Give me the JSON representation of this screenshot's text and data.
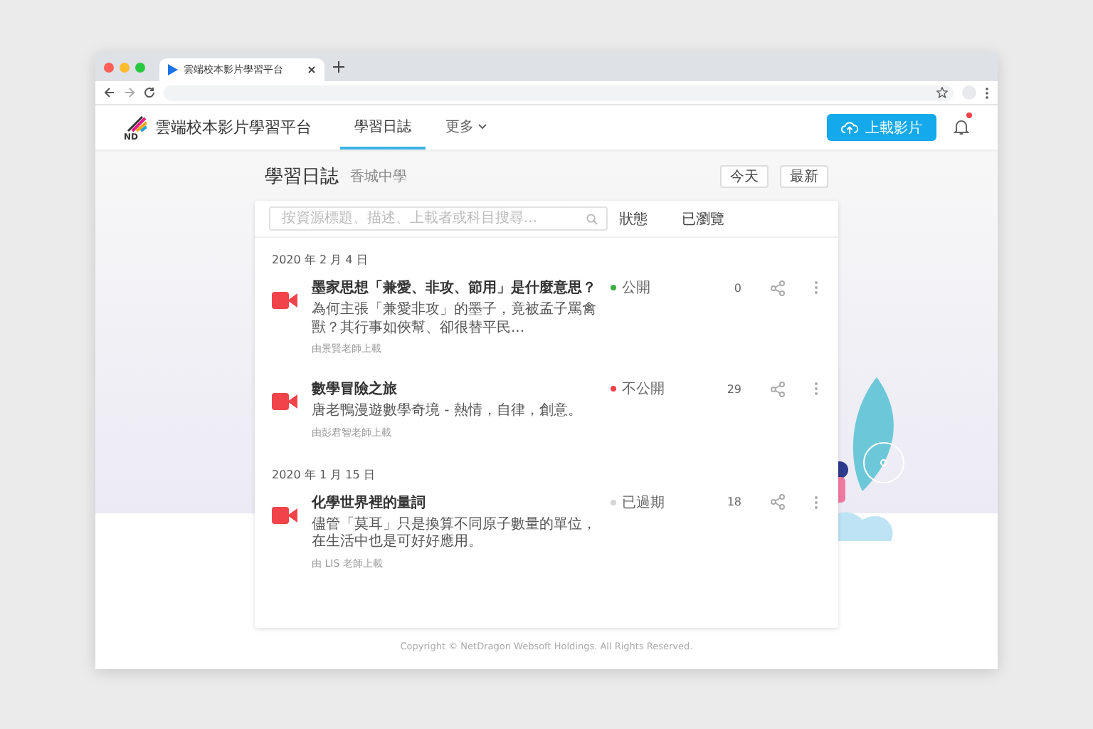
{
  "browser": {
    "tab_title": "雲端校本影片學習平台"
  },
  "header": {
    "logo_text": "ND",
    "brand": "雲端校本影片學習平台",
    "nav": [
      {
        "label": "學習日誌",
        "selected": true,
        "dropdown": false
      },
      {
        "label": "更多",
        "selected": false,
        "dropdown": true
      }
    ],
    "upload_button": "上載影片",
    "has_notification": true
  },
  "page": {
    "title": "學習日誌",
    "subtitle": "香城中學",
    "buttons": [
      "今天",
      "最新"
    ]
  },
  "search": {
    "placeholder": "按資源標題、描述、上載者或科目搜尋..."
  },
  "columns": [
    "狀態",
    "已瀏覽"
  ],
  "groups": [
    {
      "date": "2020 年 2 月 4 日",
      "items": [
        {
          "title": "墨家思想「兼愛、非攻、節用」是什麼意思？",
          "description": "為何主張「兼愛非攻」的墨子，竟被孟子罵禽獸？其行事如俠幫、卻很替平民...",
          "uploader": "由景賢老師上載",
          "status": {
            "label": "公開",
            "color": "#3cb043"
          },
          "views": "0"
        },
        {
          "title": "數學冒險之旅",
          "description": "唐老鴨漫遊數學奇境 - 熱情，自律，創意。",
          "uploader": "由彭君智老師上載",
          "status": {
            "label": "不公開",
            "color": "#f0444a"
          },
          "views": "29"
        }
      ]
    },
    {
      "date": "2020 年 1 月 15 日",
      "items": [
        {
          "title": "化學世界裡的量詞",
          "description": "儘管「莫耳」只是換算不同原子數量的單位，在生活中也是可好好應用。",
          "uploader": "由 LIS 老師上載",
          "status": {
            "label": "已過期",
            "color": "#d6d6d6"
          },
          "views": "18"
        }
      ]
    }
  ],
  "footer": "Copyright © NetDragon Websoft Holdings. All Rights Reserved."
}
